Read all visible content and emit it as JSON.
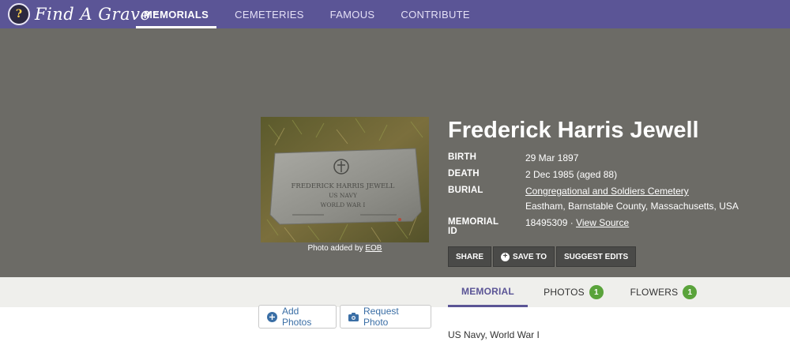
{
  "brand": {
    "logo_text": "Find A Grave",
    "logo_mark": "?",
    "accent": "#5b5596"
  },
  "nav": {
    "items": [
      {
        "label": "MEMORIALS"
      },
      {
        "label": "CEMETERIES"
      },
      {
        "label": "FAMOUS"
      },
      {
        "label": "CONTRIBUTE"
      }
    ]
  },
  "photo": {
    "caption_prefix": "Photo added by ",
    "contributor": "EOB",
    "stone_lines": [
      "FREDERICK HARRIS JEWELL",
      "US NAVY",
      "WORLD WAR I"
    ]
  },
  "memorial": {
    "name": "Frederick Harris Jewell",
    "birth_label": "BIRTH",
    "birth_value": "29 Mar 1897",
    "death_label": "DEATH",
    "death_value": "2 Dec 1985 (aged 88)",
    "burial_label": "BURIAL",
    "burial_cemetery": "Congregational and Soldiers Cemetery",
    "burial_location": "Eastham, Barnstable County, Massachusetts, USA",
    "id_label": "MEMORIAL ID",
    "id_value": "18495309",
    "id_sep": " · ",
    "view_source": "View Source"
  },
  "actions": {
    "share": "SHARE",
    "save_to": "SAVE TO",
    "suggest_edits": "SUGGEST EDITS"
  },
  "tabs": {
    "memorial": "MEMORIAL",
    "photos": "PHOTOS",
    "photos_count": "1",
    "flowers": "FLOWERS",
    "flowers_count": "1"
  },
  "below": {
    "add_photos": "Add Photos",
    "request_photo": "Request Photo",
    "bio": "US Navy, World War I"
  }
}
